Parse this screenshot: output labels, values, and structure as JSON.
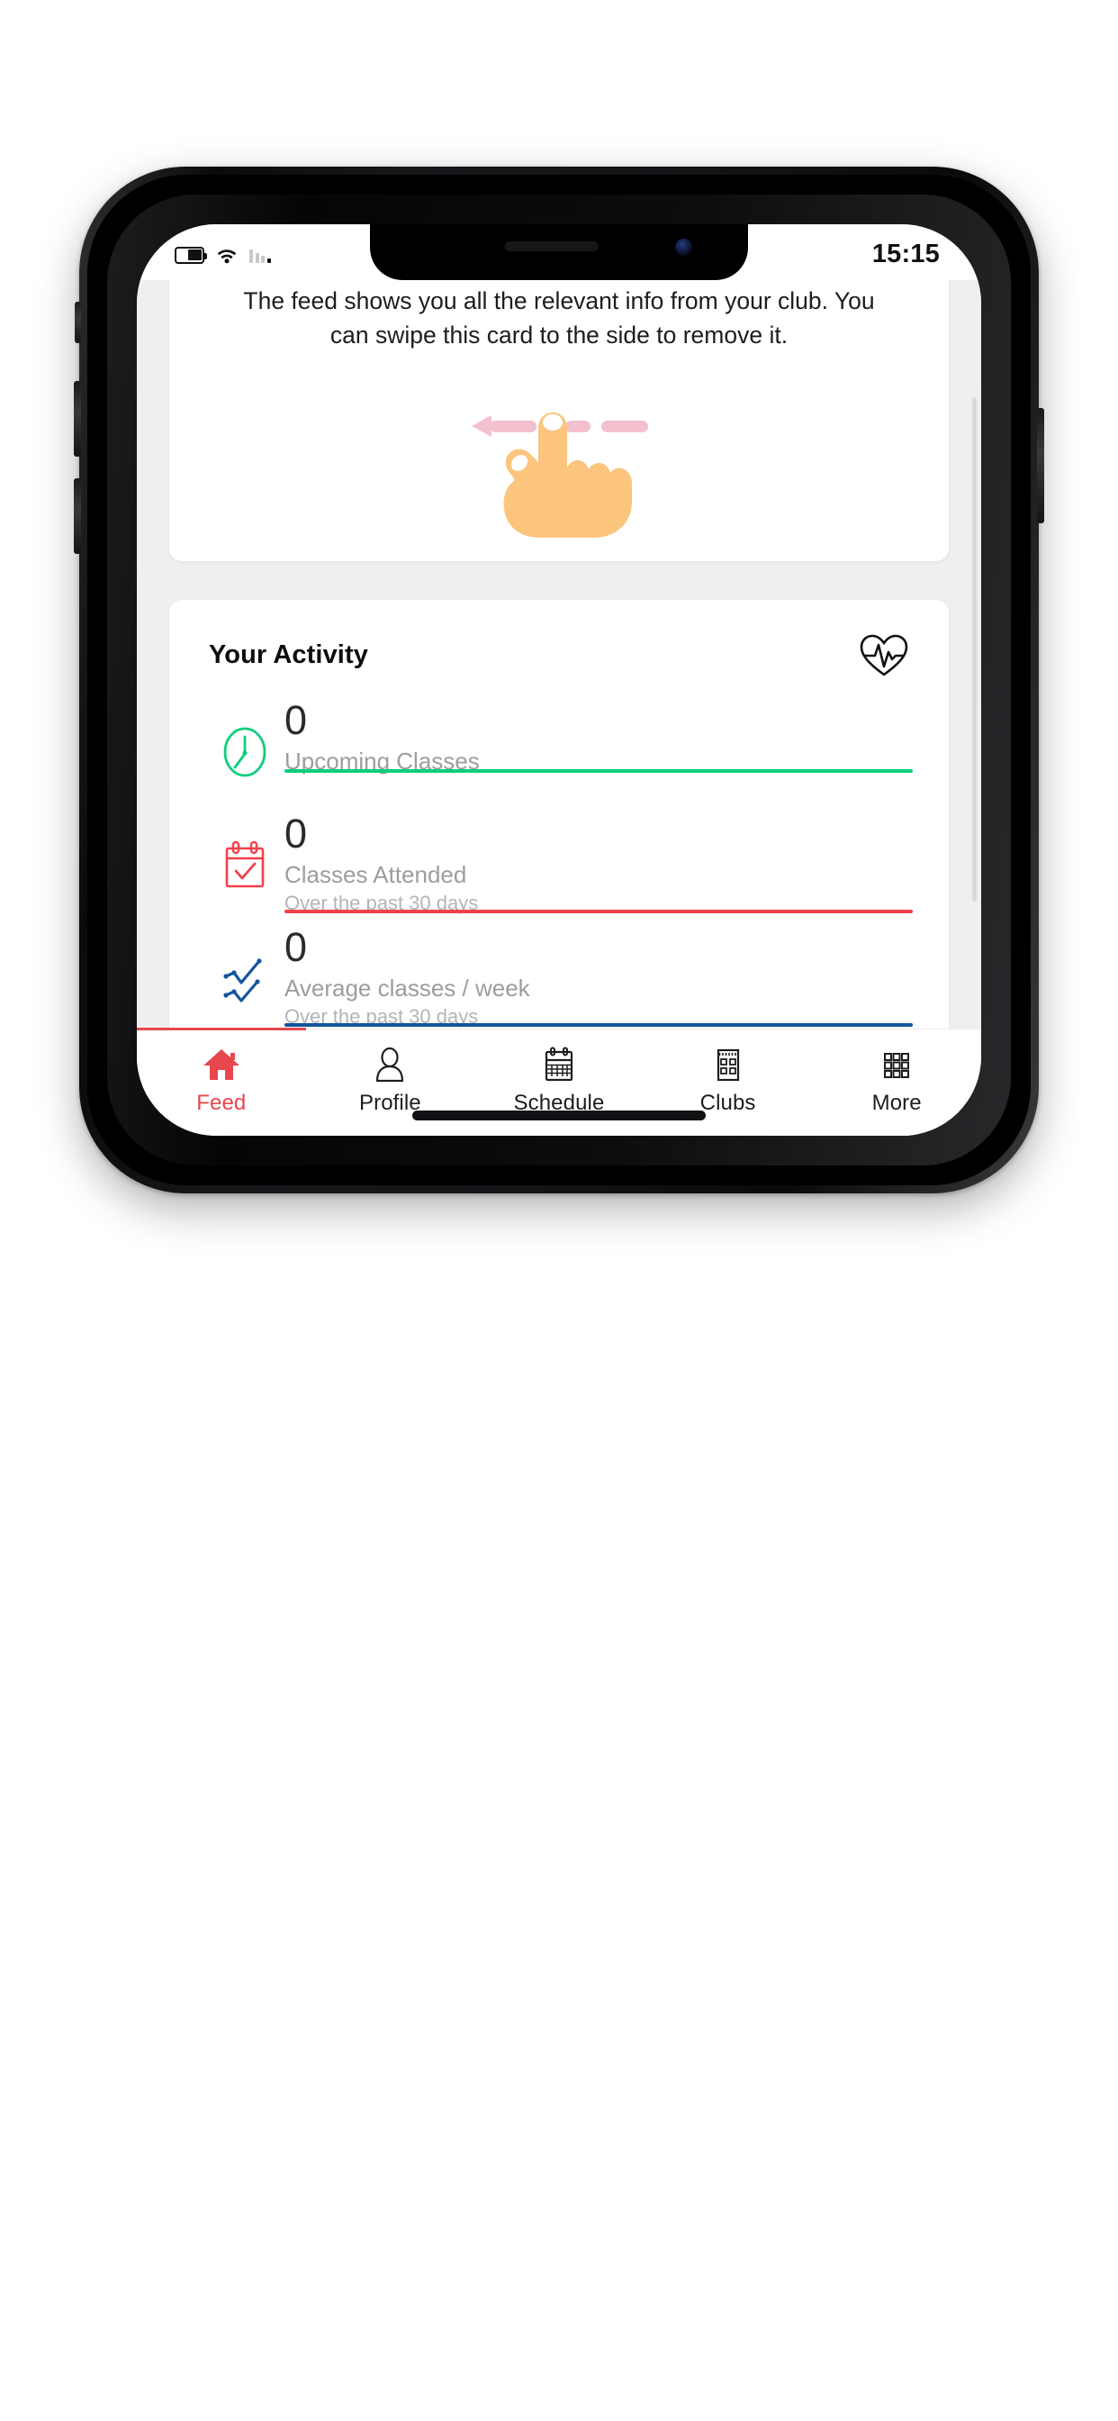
{
  "status_bar": {
    "time": "15:15",
    "battery_icon": "battery-icon",
    "wifi_icon": "wifi-icon",
    "signal_icon": "signal-bars-icon"
  },
  "tip_card": {
    "text": "The feed shows you all the relevant info from your club. You can swipe this card to the side to remove it.",
    "gesture_icon": "swipe-left-hand-icon",
    "hand_color": "#FBC57E",
    "arrow_color": "#F3C0CE"
  },
  "activity_card": {
    "title": "Your Activity",
    "title_icon": "heart-pulse-icon",
    "stats": [
      {
        "value": "0",
        "label": "Upcoming Classes",
        "sub": "",
        "icon": "clock-icon",
        "color": "#0FCE7C"
      },
      {
        "value": "0",
        "label": "Classes Attended",
        "sub": "Over the past 30 days",
        "icon": "calendar-check-icon",
        "color": "#F2404B"
      },
      {
        "value": "0",
        "label": "Average classes / week",
        "sub": "Over the past 30 days",
        "icon": "line-chart-icon",
        "color": "#14559E"
      }
    ]
  },
  "tab_bar": {
    "active_color": "#E8474D",
    "inactive_color": "#1D1D1F",
    "tabs": [
      {
        "label": "Feed",
        "icon": "home-icon",
        "active": true
      },
      {
        "label": "Profile",
        "icon": "person-icon",
        "active": false
      },
      {
        "label": "Schedule",
        "icon": "calendar-icon",
        "active": false
      },
      {
        "label": "Clubs",
        "icon": "building-icon",
        "active": false
      },
      {
        "label": "More",
        "icon": "grid-menu-icon",
        "active": false
      }
    ]
  }
}
